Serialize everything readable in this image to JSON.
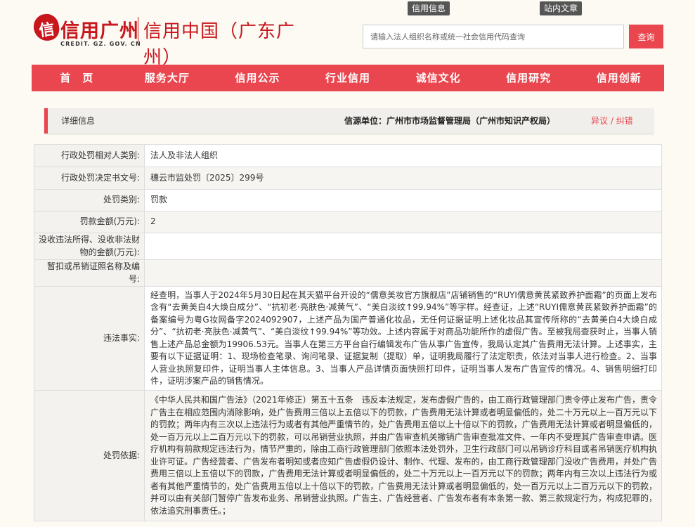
{
  "header": {
    "logo_mark": "信",
    "logo_cn": "信用广州",
    "logo_sub": "信用中国（广东广州）",
    "logo_en": "CREDIT. GZ. GOV. CN",
    "top_tabs": [
      "信用信息",
      "站内文章"
    ],
    "search_placeholder": "请输入法人组织名称或统一社会信用代码查询",
    "search_button": "查询"
  },
  "nav": [
    "首　页",
    "服务大厅",
    "信用公示",
    "行业信用",
    "诚信文化",
    "信用研究",
    "信用创新"
  ],
  "info_bar": {
    "title": "详细信息",
    "source": "信源单位：广州市市场监督管理局（广州市知识产权局）",
    "objection": "异议 / 纠错"
  },
  "rows": [
    {
      "label": "行政处罚相对人类别:",
      "value": "法人及非法人组织"
    },
    {
      "label": "行政处罚决定书文号:",
      "value": "穗云市监处罚〔2025〕299号"
    },
    {
      "label": "处罚类别:",
      "value": "罚款"
    },
    {
      "label": "罚款金额(万元):",
      "value": "2"
    },
    {
      "label": "没收违法所得、没收非法财物的金额(万元):",
      "value": ""
    },
    {
      "label": "暂扣或吊销证照名称及编号:",
      "value": ""
    },
    {
      "label": "违法事实:",
      "value": "经查明，当事人于2024年5月30日起在其天猫平台开设的“儒意美妆官方旗舰店”店铺销售的“RUYI儒意黄芪紧致养护面霜”的页面上发布含有“去黄美白4大焕白成分”、“抗初老·亮肤色·减黄气”、“美白淡纹↑99.94%”等字样。经查证，上述“RUYI儒意黄芪紧致养护面霜”的备案编号为粤G妆网备字2024092907，上述产品为国产普通化妆品，无任何证据证明上述化妆品其宣传所称的“去黄美白4大焕白成分”、“抗初老·亮肤色·减黄气”、“美白淡纹↑99.94%”等功效。上述内容属于对商品功能所作的虚假广告。至被我局查获时止，当事人销售上述产品总金额为19906.53元。当事人在第三方平台自行编辑发布广告从事广告宣传，我局认定其广告费用无法计算。上述事实，主要有以下证据证明：1、现场检查笔录、询问笔录、证据复制（提取）单，证明我局履行了法定职责，依法对当事人进行检查。2、当事人营业执照复印件，证明当事人主体信息。3、当事人产品详情页面快照打印件，证明当事人发布广告宣传的情况。4、销售明细打印件，证明涉案产品的销售情况。"
    },
    {
      "label": "处罚依据:",
      "value": "《中华人民共和国广告法》（2021年修正）第五十五条　违反本法规定，发布虚假广告的，由工商行政管理部门责令停止发布广告，责令广告主在相应范围内消除影响，处广告费用三倍以上五倍以下的罚款，广告费用无法计算或者明显偏低的，处二十万元以上一百万元以下的罚款；两年内有三次以上违法行为或者有其他严重情节的，处广告费用五倍以上十倍以下的罚款，广告费用无法计算或者明显偏低的，处一百万元以上二百万元以下的罚款，可以吊销营业执照，并由广告审查机关撤销广告审查批准文件、一年内不受理其广告审查申请。医疗机构有前款规定违法行为，情节严重的，除由工商行政管理部门依照本法处罚外，卫生行政部门可以吊销诊疗科目或者吊销医疗机构执业许可证。广告经营者、广告发布者明知或者应知广告虚假仍设计、制作、代理、发布的，由工商行政管理部门没收广告费用，并处广告费用三倍以上五倍以下的罚款，广告费用无法计算或者明显偏低的，处二十万元以上一百万元以下的罚款；两年内有三次以上违法行为或者有其他严重情节的，处广告费用五倍以上十倍以下的罚款，广告费用无法计算或者明显偏低的，处一百万元以上二百万元以下的罚款，并可以由有关部门暂停广告发布业务、吊销营业执照。广告主、广告经营者、广告发布者有本条第一款、第三款规定行为，构成犯罪的，依法追究刑事责任。；"
    }
  ]
}
